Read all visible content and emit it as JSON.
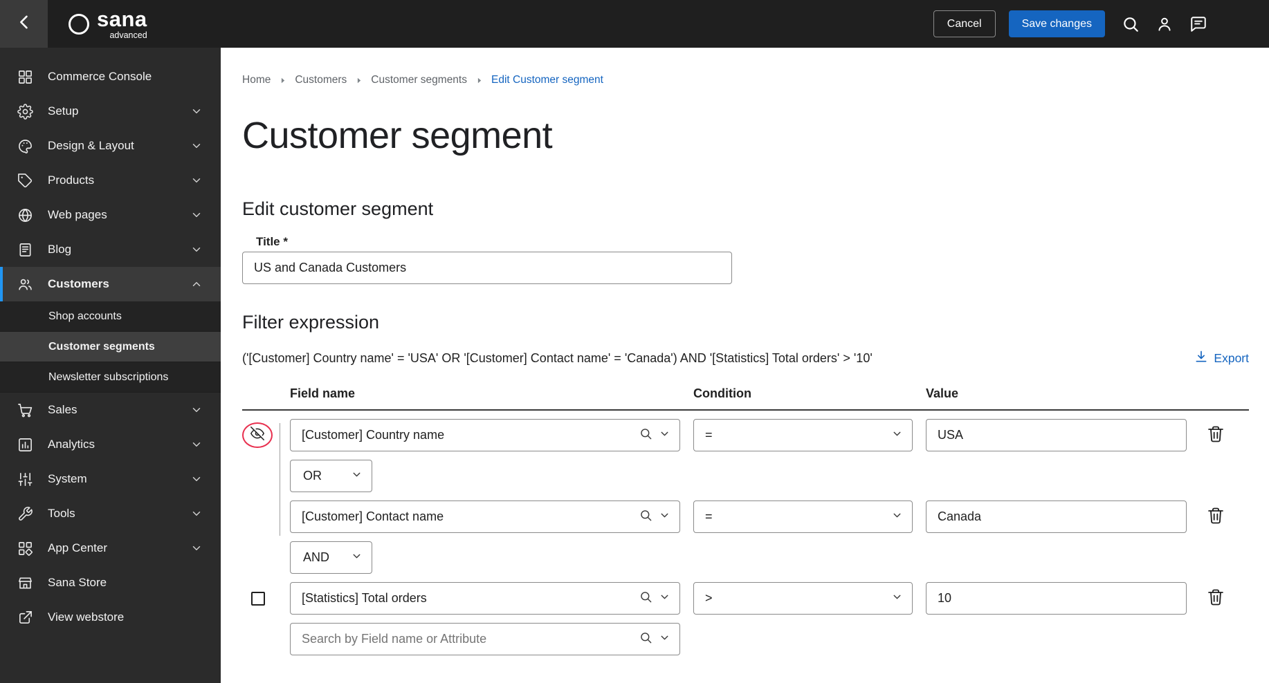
{
  "topbar": {
    "logo": {
      "text": "sana",
      "sub": "advanced"
    },
    "cancel_label": "Cancel",
    "save_label": "Save changes"
  },
  "sidebar": {
    "items": [
      {
        "label": "Commerce Console"
      },
      {
        "label": "Setup"
      },
      {
        "label": "Design & Layout"
      },
      {
        "label": "Products"
      },
      {
        "label": "Web pages"
      },
      {
        "label": "Blog"
      },
      {
        "label": "Customers"
      },
      {
        "label": "Sales"
      },
      {
        "label": "Analytics"
      },
      {
        "label": "System"
      },
      {
        "label": "Tools"
      },
      {
        "label": "App Center"
      },
      {
        "label": "Sana Store"
      },
      {
        "label": "View webstore"
      }
    ],
    "customers_subitems": [
      {
        "label": "Shop accounts"
      },
      {
        "label": "Customer segments"
      },
      {
        "label": "Newsletter subscriptions"
      }
    ]
  },
  "breadcrumb": {
    "items": [
      {
        "label": "Home"
      },
      {
        "label": "Customers"
      },
      {
        "label": "Customer segments"
      },
      {
        "label": "Edit Customer segment"
      }
    ]
  },
  "page": {
    "title": "Customer segment",
    "edit_section_title": "Edit customer segment",
    "title_field": {
      "label": "Title *",
      "value": "US and Canada Customers"
    },
    "filter": {
      "section_title": "Filter expression",
      "expression": "('[Customer] Country name' = 'USA' OR '[Customer] Contact name' = 'Canada') AND '[Statistics] Total orders' > '10'",
      "export_label": "Export",
      "columns": {
        "field": "Field name",
        "condition": "Condition",
        "value": "Value"
      },
      "rows": [
        {
          "field": "[Customer] Country name",
          "condition": "=",
          "value": "USA"
        },
        {
          "field": "[Customer] Contact name",
          "condition": "=",
          "value": "Canada"
        },
        {
          "field": "[Statistics] Total orders",
          "condition": ">",
          "value": "10"
        }
      ],
      "group_operator": "OR",
      "root_operator": "AND",
      "search_placeholder": "Search by Field name or Attribute"
    }
  },
  "colors": {
    "accent_blue": "#1565c0",
    "sidebar_active_bar": "#2196f3",
    "annotation_red": "#e8304f"
  }
}
